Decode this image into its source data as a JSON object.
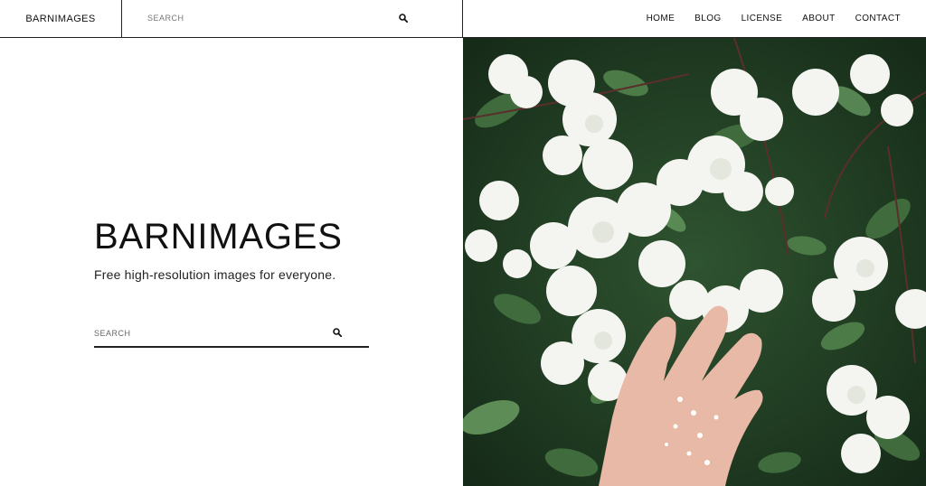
{
  "header": {
    "brand": "BARNIMAGES",
    "search_placeholder": "SEARCH",
    "nav": [
      "HOME",
      "BLOG",
      "LICENSE",
      "ABOUT",
      "CONTACT"
    ]
  },
  "hero": {
    "title": "BARNIMAGES",
    "subtitle": "Free high-resolution images for everyone.",
    "search_placeholder": "SEARCH"
  },
  "icons": {
    "search": "search-icon"
  },
  "colors": {
    "text": "#111111",
    "border": "#222222",
    "foliage_dark": "#1f3a22",
    "foliage": "#3f6b3d",
    "blossom": "#f4f4f0",
    "skin": "#e8b9a6"
  }
}
